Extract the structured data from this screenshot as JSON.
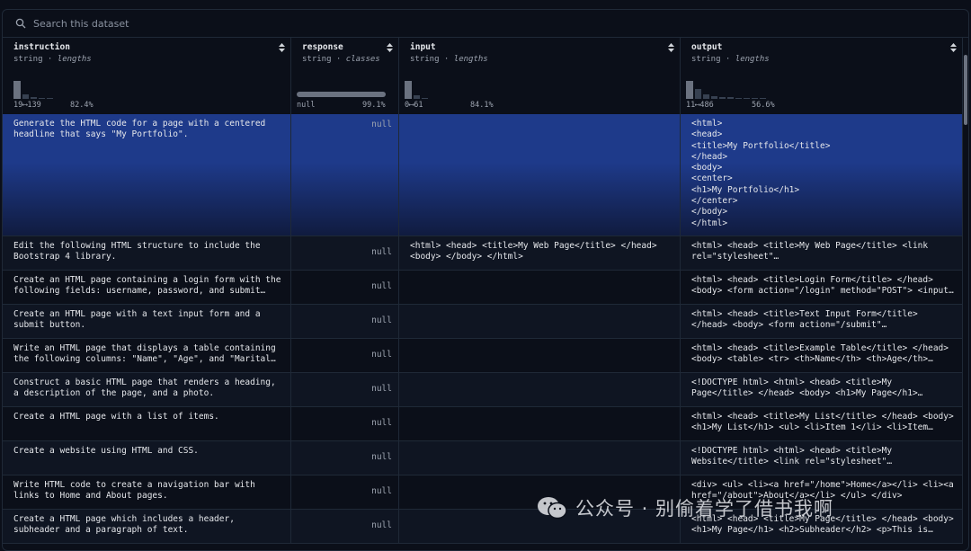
{
  "search": {
    "placeholder": "Search this dataset"
  },
  "columns": [
    {
      "name": "instruction",
      "type": "string",
      "stat": "lengths",
      "range": "19⟷139",
      "pct": "82.4%",
      "hist": [
        20,
        5,
        2,
        1,
        1
      ]
    },
    {
      "name": "response",
      "type": "string",
      "stat": "classes",
      "range": "null",
      "pct": "99.1%",
      "bar": 0.991
    },
    {
      "name": "input",
      "type": "string",
      "stat": "lengths",
      "range": "0⟷61",
      "pct": "84.1%",
      "hist": [
        22,
        4,
        1
      ]
    },
    {
      "name": "output",
      "type": "string",
      "stat": "lengths",
      "range": "11⟷486",
      "pct": "56.6%",
      "hist": [
        22,
        12,
        6,
        3,
        2,
        2,
        1,
        1,
        1,
        1
      ]
    }
  ],
  "rows": [
    {
      "instruction": "Generate the HTML code for a page with a centered headline that says \"My Portfolio\".",
      "response": "null",
      "input": "",
      "output": "<html>\n<head>\n<title>My Portfolio</title>\n</head>\n<body>\n<center>\n<h1>My Portfolio</h1>\n</center>\n</body>\n</html>"
    },
    {
      "instruction": "Edit the following HTML structure to include the Bootstrap 4 library.",
      "response": "null",
      "input": "<html> <head> <title>My Web Page</title> </head> <body> </body> </html>",
      "output": "<html> <head> <title>My Web Page</title> <link rel=\"stylesheet\"…"
    },
    {
      "instruction": "Create an HTML page containing a login form with the following fields: username, password, and submit…",
      "response": "null",
      "input": "",
      "output": "<html> <head> <title>Login Form</title> </head> <body> <form action=\"/login\" method=\"POST\"> <input…"
    },
    {
      "instruction": "Create an HTML page with a text input form and a submit button.",
      "response": "null",
      "input": "",
      "output": "<html> <head> <title>Text Input Form</title> </head> <body> <form action=\"/submit\" method=\"POST\"> <input…"
    },
    {
      "instruction": "Write an HTML page that displays a table containing the following columns: \"Name\", \"Age\", and \"Marital…",
      "response": "null",
      "input": "",
      "output": "<html> <head> <title>Example Table</title> </head> <body> <table> <tr> <th>Name</th> <th>Age</th>…"
    },
    {
      "instruction": "Construct a basic HTML page that renders a heading, a description of the page, and a photo.",
      "response": "null",
      "input": "",
      "output": "<!DOCTYPE html> <html> <head> <title>My Page</title> </head> <body> <h1>My Page</h1> <p>This is my first…"
    },
    {
      "instruction": "Create a HTML page with a list of items.",
      "response": "null",
      "input": "",
      "output": "<html> <head> <title>My List</title> </head> <body> <h1>My List</h1> <ul> <li>Item 1</li> <li>Item 2</li>…"
    },
    {
      "instruction": "Create a website using HTML and CSS.",
      "response": "null",
      "input": "",
      "output": "<!DOCTYPE html> <html> <head> <title>My Website</title> <link rel=\"stylesheet\"…"
    },
    {
      "instruction": "Write HTML code to create a navigation bar with links to Home and About pages.",
      "response": "null",
      "input": "",
      "output": "<div> <ul> <li><a href=\"/home\">Home</a></li> <li><a href=\"/about\">About</a></li> </ul> </div>"
    },
    {
      "instruction": "Create a HTML page which includes a header, subheader and a paragraph of text.",
      "response": "null",
      "input": "",
      "output": "<html> <head> <title>My Page</title> </head> <body> <h1>My Page</h1> <h2>Subheader</h2> <p>This is some…"
    }
  ],
  "watermark": {
    "text": "公众号 · 别偷着学了借书我啊"
  }
}
